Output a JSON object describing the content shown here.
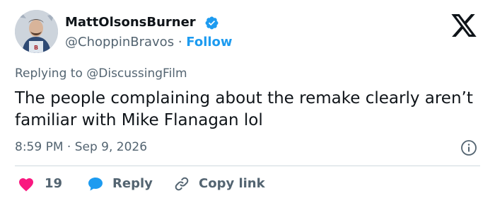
{
  "author": {
    "display_name": "MattOlsonsBurner",
    "handle": "@ChoppinBravos",
    "separator": "·",
    "follow_label": "Follow"
  },
  "tweet": {
    "replying_prefix": "Replying to",
    "replying_to": "@DiscussingFilm",
    "text": "The people complaining about the remake clearly aren’t familiar with Mike Flanagan lol",
    "time": "8:59 PM",
    "date_separator": "·",
    "date": "Sep 9, 2026"
  },
  "actions": {
    "like_count": "19",
    "reply_label": "Reply",
    "copy_label": "Copy link"
  },
  "colors": {
    "accent": "#1d9bf0",
    "like": "#f91880",
    "text": "#0f1419",
    "secondary": "#536471",
    "divider": "#cfd9de"
  },
  "icons": [
    "verified-badge-icon",
    "x-logo-icon",
    "info-icon",
    "heart-icon",
    "reply-bubble-icon",
    "link-icon"
  ]
}
